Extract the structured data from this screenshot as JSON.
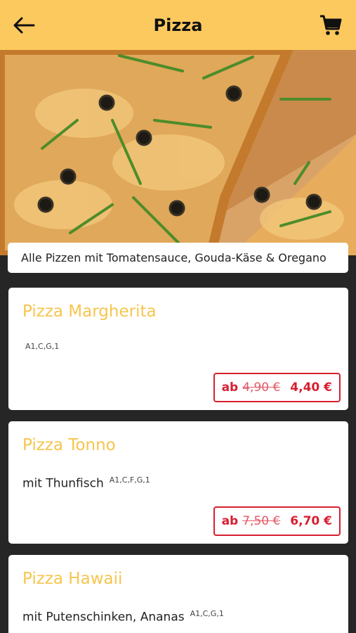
{
  "header": {
    "title": "Pizza",
    "back_icon": "arrow-left-icon",
    "cart_icon": "cart-icon"
  },
  "colors": {
    "header_bg": "#fcc95e",
    "accent": "#f6c54d",
    "price_red": "#d71f30",
    "background": "#262626"
  },
  "info": {
    "text": "Alle Pizzen mit Tomatensauce, Gouda-Käse & Oregano"
  },
  "items": [
    {
      "name": "Pizza Margherita",
      "description": "",
      "allergens": "A1,C,G,1",
      "price_prefix": "ab",
      "old_price": "4,90 €",
      "price": "4,40 €"
    },
    {
      "name": "Pizza Tonno",
      "description": "mit Thunfisch",
      "allergens": "A1,C,F,G,1",
      "price_prefix": "ab",
      "old_price": "7,50 €",
      "price": "6,70 €"
    },
    {
      "name": "Pizza Hawaii",
      "description": "mit Putenschinken, Ananas",
      "allergens": "A1,C,G,1"
    }
  ]
}
